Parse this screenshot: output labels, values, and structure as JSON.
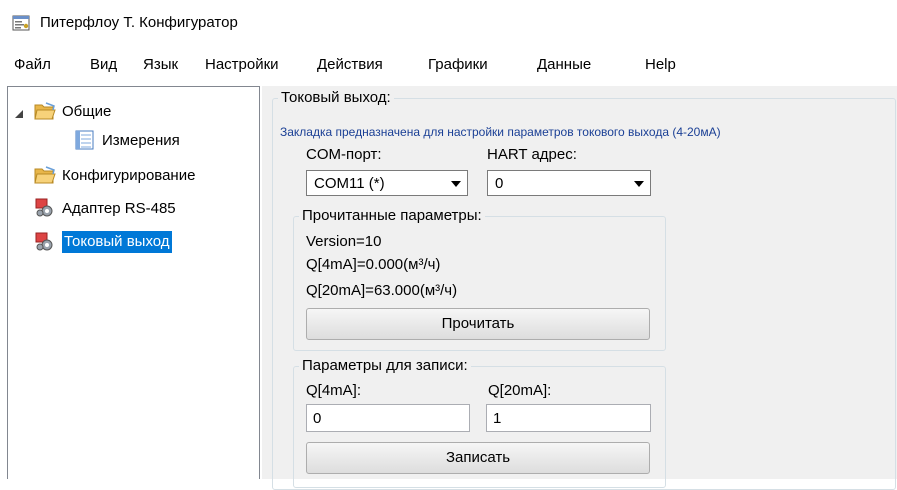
{
  "window": {
    "title": "Питерфлоу Т. Конфигуратор"
  },
  "menu": [
    "Файл",
    "Вид",
    "Язык",
    "Настройки",
    "Действия",
    "Графики",
    "Данные",
    "Help"
  ],
  "tree": {
    "general": "Общие",
    "measurements": "Измерения",
    "configuration": "Конфигурирование",
    "adapter": "Адаптер RS-485",
    "current_output": "Токовый выход"
  },
  "panel": {
    "group_title": "Токовый выход:",
    "description": "Закладка предназначена для настройки параметров токового выхода (4-20мА)",
    "com_label": "COM-порт:",
    "com_value": "COM11 (*)",
    "hart_label": "HART адрес:",
    "hart_value": "0",
    "read_group": {
      "title": "Прочитанные параметры:",
      "version": "Version=10",
      "q4": "Q[4mA]=0.000(м³/ч)",
      "q20": "Q[20mA]=63.000(м³/ч)",
      "read_button": "Прочитать"
    },
    "write_group": {
      "title": "Параметры для записи:",
      "q4_label": "Q[4mA]:",
      "q20_label": "Q[20mA]:",
      "q4_value": "0",
      "q20_value": "1",
      "write_button": "Записать"
    }
  },
  "colors": {
    "selection": "#0078d7",
    "note": "#1a3f95",
    "panel_bg": "#f0f0f0"
  }
}
